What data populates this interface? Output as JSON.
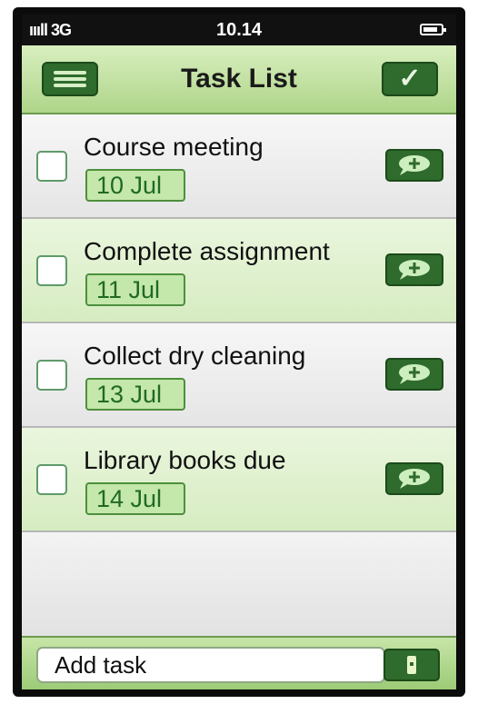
{
  "status_bar": {
    "signal": "ıııll 3G",
    "time": "10.14"
  },
  "nav": {
    "title": "Task List",
    "done_label": "✓"
  },
  "tasks": [
    {
      "title": "Course meeting",
      "date": "10 Jul"
    },
    {
      "title": "Complete assignment",
      "date": "11 Jul"
    },
    {
      "title": "Collect dry cleaning",
      "date": "13 Jul"
    },
    {
      "title": "Library books due",
      "date": "14 Jul"
    }
  ],
  "bottom": {
    "input_placeholder": "Add task"
  },
  "colors": {
    "accent_dark_green": "#2e6b2c",
    "bar_light_green": "#c7e5a8",
    "date_chip_bg": "#c4e7ab"
  },
  "icons": {
    "menu": "menu-icon",
    "done": "checkmark-icon",
    "note": "speech-bubble-add-icon",
    "add": "add-task-icon"
  }
}
